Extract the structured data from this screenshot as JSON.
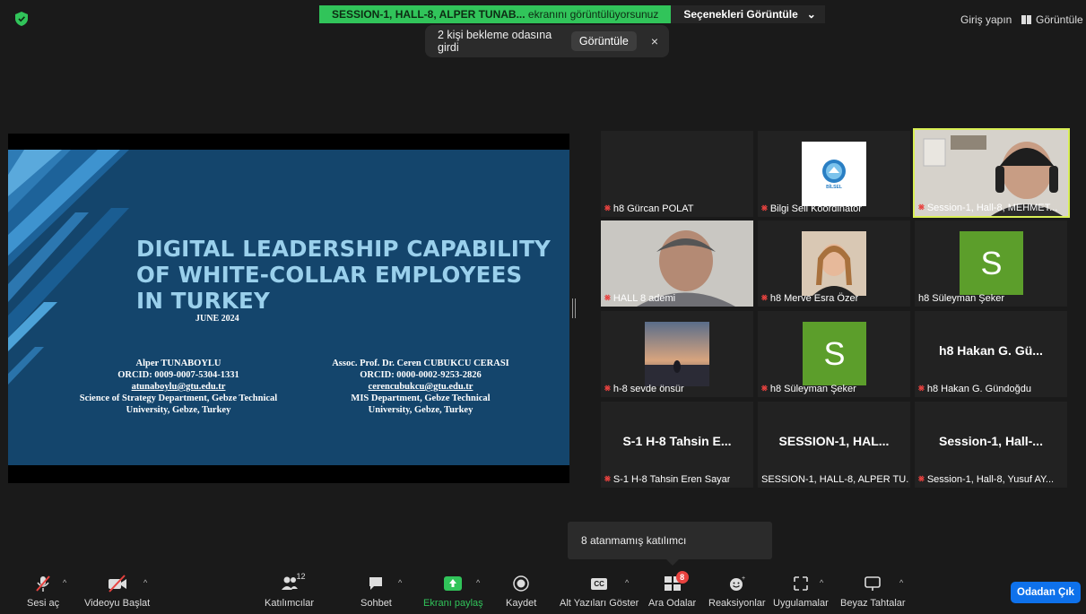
{
  "top_bar": {
    "share_text_bold": "SESSION-1, HALL-8, ALPER TUNAB...",
    "share_text": "ekranını görüntülüyorsunuz",
    "options_label": "Seçenekleri Görüntüle",
    "login_label": "Giriş yapın",
    "view_label": "Görüntüle"
  },
  "waiting_toast": {
    "message": "2 kişi bekleme odasına girdi",
    "view_button": "Görüntüle",
    "close": "×"
  },
  "slide": {
    "title_line1": "DIGITAL LEADERSHIP CAPABILITY",
    "title_line2": "OF WHITE-COLLAR EMPLOYEES",
    "title_line3": "IN TURKEY",
    "date": "JUNE 2024",
    "author1": {
      "name": "Alper TUNABOYLU",
      "orcid": "ORCID: 0009-0007-5304-1331",
      "email": "atunaboylu@gtu.edu.tr",
      "dept1": "Science of Strategy Department, Gebze Technical",
      "dept2": "University, Gebze, Turkey"
    },
    "author2": {
      "name": "Assoc. Prof. Dr. Ceren CUBUKCU CERASI",
      "orcid": "ORCID: 0000-0002-9253-2826",
      "email": "cerencubukcu@gtu.edu.tr",
      "dept1": "MIS Department, Gebze Technical",
      "dept2": "University, Gebze, Turkey"
    }
  },
  "gallery": [
    {
      "name": "h8 Gürcan POLAT",
      "muted": true
    },
    {
      "name": "Bilgi Seli Koordinatör",
      "muted": true,
      "logo_text": "BİLSEL"
    },
    {
      "name": "Session-1, Hall-8, MEHMET...",
      "muted": true,
      "active": true
    },
    {
      "name": "HALL 8 ademi",
      "muted": true
    },
    {
      "name": "h8 Merve Esra Özer",
      "muted": true
    },
    {
      "name": "h8 Süleyman Şeker",
      "muted": false,
      "avatar": "S"
    },
    {
      "name": "h-8 sevde önsür",
      "muted": true
    },
    {
      "name": "h8 Süleyman Şeker",
      "muted": true,
      "avatar": "S"
    },
    {
      "name": "h8 Hakan G. Gündoğdu",
      "muted": true,
      "big": "h8 Hakan G. Gü..."
    },
    {
      "name": "S-1 H-8 Tahsin Eren Sayar",
      "muted": true,
      "big": "S-1 H-8 Tahsin E..."
    },
    {
      "name": "SESSION-1, HALL-8, ALPER TU...",
      "muted": false,
      "big": "SESSION-1, HAL..."
    },
    {
      "name": "Session-1, Hall-8, Yusuf AY...",
      "muted": true,
      "big": "Session-1, Hall-..."
    }
  ],
  "popover": {
    "text": "8 atanmamış katılımcı"
  },
  "toolbar": {
    "unmute": "Sesi aç",
    "start_video": "Videoyu Başlat",
    "participants": "Katılımcılar",
    "participants_count": "12",
    "chat": "Sohbet",
    "share": "Ekranı paylaş",
    "record": "Kaydet",
    "captions": "Alt Yazıları Göster",
    "captions_icon": "CC",
    "breakout": "Ara Odalar",
    "breakout_badge": "8",
    "reactions": "Reaksiyonlar",
    "apps": "Uygulamalar",
    "whiteboard": "Beyaz Tahtalar",
    "leave": "Odadan Çık"
  },
  "colors": {
    "accent_green": "#31c45a",
    "leave_blue": "#0e71eb",
    "muted_red": "#e8423f",
    "active_border": "#d9ef55"
  }
}
